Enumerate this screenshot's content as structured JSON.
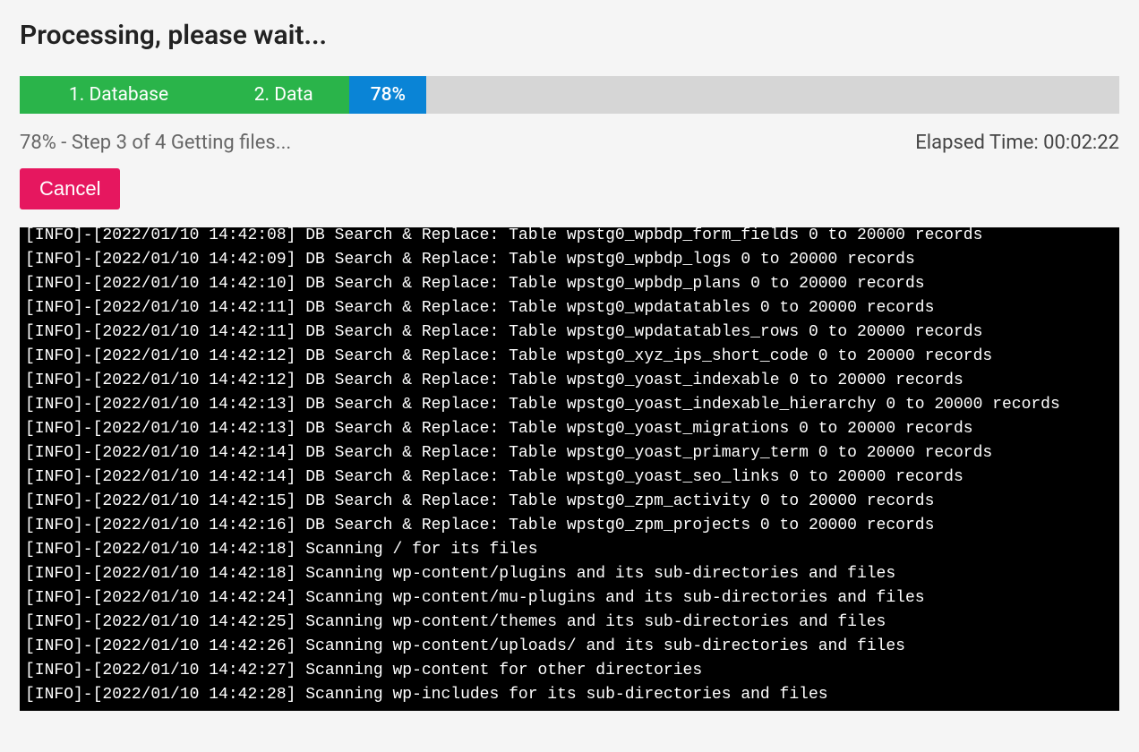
{
  "title": "Processing, please wait...",
  "progress": {
    "segments": [
      {
        "label": "1. Database"
      },
      {
        "label": "2. Data"
      },
      {
        "label": "78%"
      }
    ]
  },
  "status": {
    "left": "78% - Step 3 of 4 Getting files...",
    "right": "Elapsed Time: 00:02:22"
  },
  "cancel_label": "Cancel",
  "log_lines": [
    "[INFO]-[2022/01/10 14:42:08] DB Search & Replace: Table wpstg0_wpbdp_form_fields 0 to 20000 records",
    "[INFO]-[2022/01/10 14:42:09] DB Search & Replace: Table wpstg0_wpbdp_logs 0 to 20000 records",
    "[INFO]-[2022/01/10 14:42:10] DB Search & Replace: Table wpstg0_wpbdp_plans 0 to 20000 records",
    "[INFO]-[2022/01/10 14:42:11] DB Search & Replace: Table wpstg0_wpdatatables 0 to 20000 records",
    "[INFO]-[2022/01/10 14:42:11] DB Search & Replace: Table wpstg0_wpdatatables_rows 0 to 20000 records",
    "[INFO]-[2022/01/10 14:42:12] DB Search & Replace: Table wpstg0_xyz_ips_short_code 0 to 20000 records",
    "[INFO]-[2022/01/10 14:42:12] DB Search & Replace: Table wpstg0_yoast_indexable 0 to 20000 records",
    "[INFO]-[2022/01/10 14:42:13] DB Search & Replace: Table wpstg0_yoast_indexable_hierarchy 0 to 20000 records",
    "[INFO]-[2022/01/10 14:42:13] DB Search & Replace: Table wpstg0_yoast_migrations 0 to 20000 records",
    "[INFO]-[2022/01/10 14:42:14] DB Search & Replace: Table wpstg0_yoast_primary_term 0 to 20000 records",
    "[INFO]-[2022/01/10 14:42:14] DB Search & Replace: Table wpstg0_yoast_seo_links 0 to 20000 records",
    "[INFO]-[2022/01/10 14:42:15] DB Search & Replace: Table wpstg0_zpm_activity 0 to 20000 records",
    "[INFO]-[2022/01/10 14:42:16] DB Search & Replace: Table wpstg0_zpm_projects 0 to 20000 records",
    "[INFO]-[2022/01/10 14:42:18] Scanning / for its files",
    "[INFO]-[2022/01/10 14:42:18] Scanning wp-content/plugins and its sub-directories and files",
    "[INFO]-[2022/01/10 14:42:24] Scanning wp-content/mu-plugins and its sub-directories and files",
    "[INFO]-[2022/01/10 14:42:25] Scanning wp-content/themes and its sub-directories and files",
    "[INFO]-[2022/01/10 14:42:26] Scanning wp-content/uploads/ and its sub-directories and files",
    "[INFO]-[2022/01/10 14:42:27] Scanning wp-content for other directories",
    "[INFO]-[2022/01/10 14:42:28] Scanning wp-includes for its sub-directories and files"
  ]
}
